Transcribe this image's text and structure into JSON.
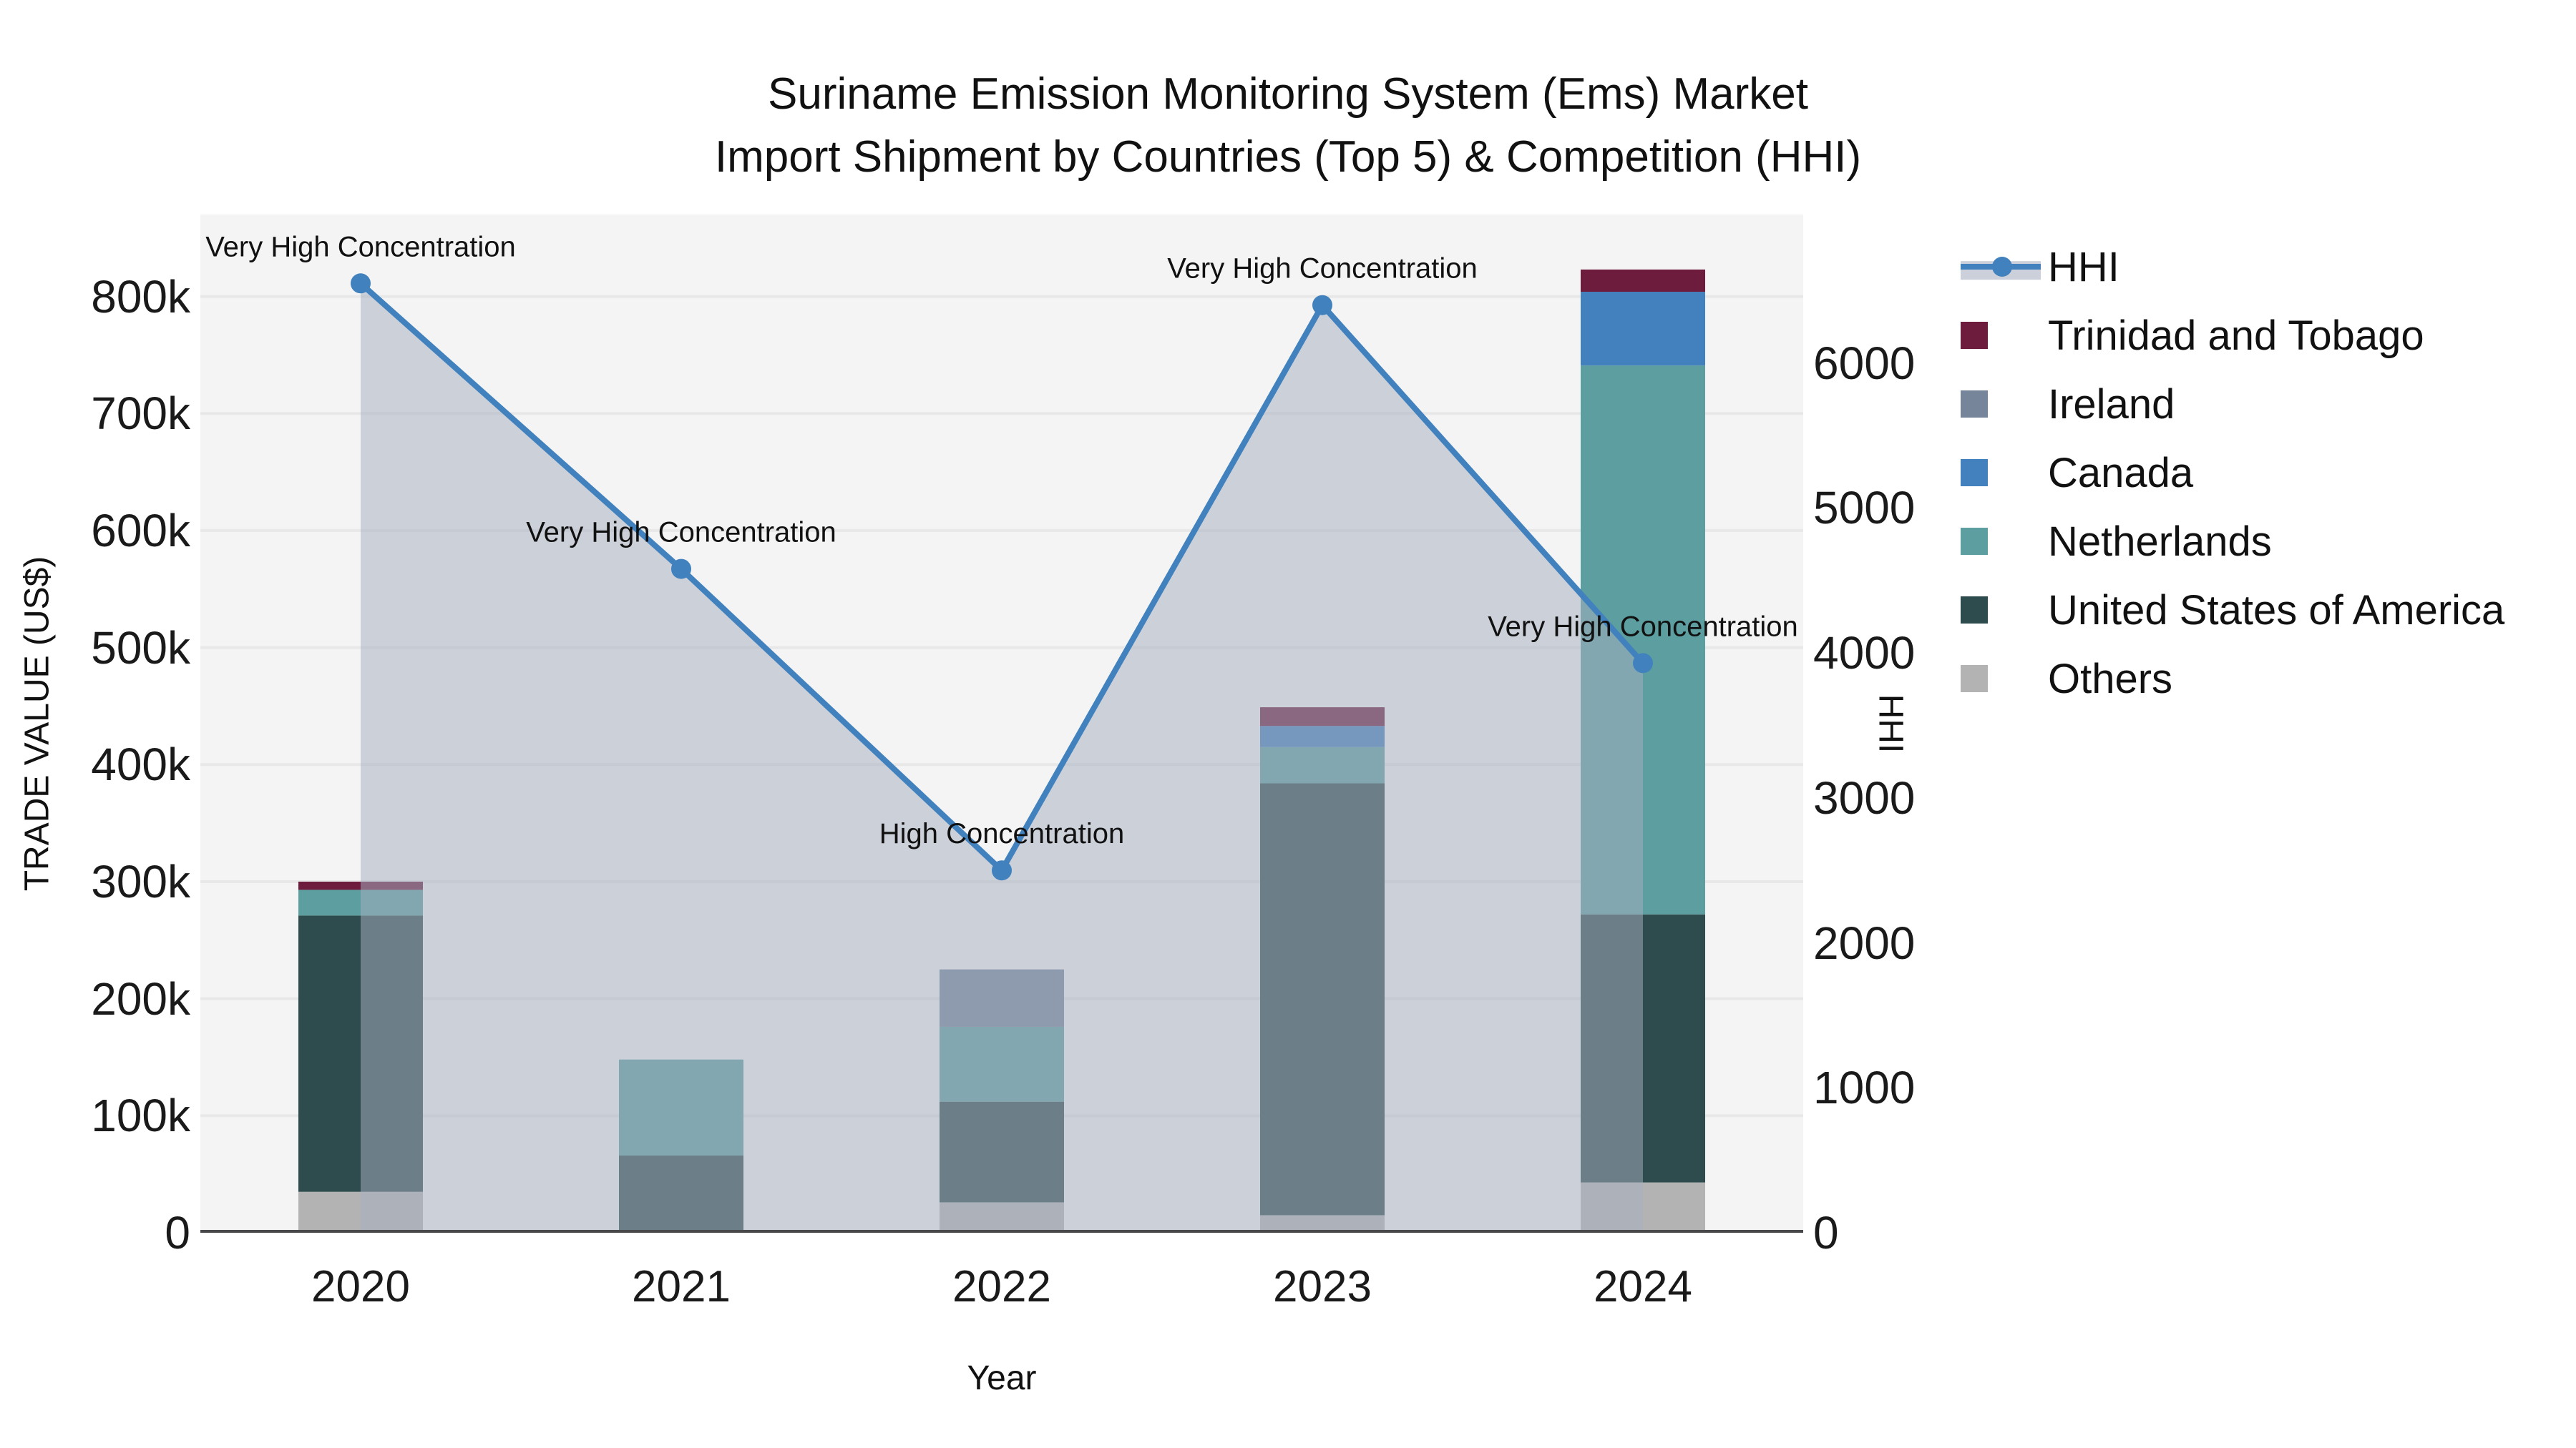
{
  "title": {
    "line1": "Suriname Emission Monitoring System (Ems) Market",
    "line2": "Import Shipment by Countries (Top 5) & Competition (HHI)"
  },
  "axes": {
    "x": {
      "title": "Year",
      "tick_labels": [
        "2020",
        "2021",
        "2022",
        "2023",
        "2024"
      ]
    },
    "y_left": {
      "title": "TRADE VALUE (US$)",
      "tick_labels": [
        "0",
        "100k",
        "200k",
        "300k",
        "400k",
        "500k",
        "600k",
        "700k",
        "800k"
      ],
      "tick_values": [
        0,
        100000,
        200000,
        300000,
        400000,
        500000,
        600000,
        700000,
        800000
      ]
    },
    "y_right": {
      "title": "HHI",
      "tick_labels": [
        "0",
        "1000",
        "2000",
        "3000",
        "4000",
        "5000",
        "6000"
      ],
      "tick_values": [
        0,
        1000,
        2000,
        3000,
        4000,
        5000,
        6000
      ]
    }
  },
  "legend": {
    "items": [
      {
        "label": "HHI",
        "type": "line",
        "color": "#4181bd",
        "band": "#cbd0da"
      },
      {
        "label": "Trinidad and Tobago",
        "type": "square",
        "color": "#6d1c3d"
      },
      {
        "label": "Ireland",
        "type": "square",
        "color": "#76859a"
      },
      {
        "label": "Canada",
        "type": "square",
        "color": "#4381be"
      },
      {
        "label": "Netherlands",
        "type": "square",
        "color": "#5d9fa0"
      },
      {
        "label": "United States of America",
        "type": "square",
        "color": "#2e4c4d"
      },
      {
        "label": "Others",
        "type": "square",
        "color": "#b3b3b3"
      }
    ]
  },
  "chart_data": {
    "type": "bar",
    "subtype": "stacked-bar-with-line",
    "categories": [
      "2020",
      "2021",
      "2022",
      "2023",
      "2024"
    ],
    "bar_value_unit": "US$",
    "stack_order_bottom_to_top": [
      "Others",
      "United States of America",
      "Netherlands",
      "Canada",
      "Ireland",
      "Trinidad and Tobago"
    ],
    "series": [
      {
        "name": "Trinidad and Tobago",
        "type": "bar",
        "color": "#6d1c3d",
        "values": [
          7000,
          0,
          0,
          16000,
          19000
        ]
      },
      {
        "name": "Ireland",
        "type": "bar",
        "color": "#76859a",
        "values": [
          0,
          0,
          49000,
          0,
          0
        ]
      },
      {
        "name": "Canada",
        "type": "bar",
        "color": "#4381be",
        "values": [
          0,
          0,
          0,
          18000,
          63000
        ]
      },
      {
        "name": "Netherlands",
        "type": "bar",
        "color": "#5d9fa0",
        "values": [
          22000,
          82000,
          64000,
          31000,
          469000
        ]
      },
      {
        "name": "United States of America",
        "type": "bar",
        "color": "#2e4c4d",
        "values": [
          236000,
          66000,
          86000,
          369000,
          229000
        ]
      },
      {
        "name": "Others",
        "type": "bar",
        "color": "#b3b3b3",
        "values": [
          35000,
          0,
          26000,
          15000,
          43000
        ]
      },
      {
        "name": "HHI",
        "type": "line",
        "axis": "right",
        "color": "#4181bd",
        "area_fill": "rgba(164,174,192,0.52)",
        "values": [
          6550,
          4580,
          2500,
          6400,
          3930
        ]
      }
    ],
    "annotations": [
      {
        "category": "2020",
        "text": "Very High Concentration"
      },
      {
        "category": "2021",
        "text": "Very High Concentration"
      },
      {
        "category": "2022",
        "text": "High Concentration"
      },
      {
        "category": "2023",
        "text": "Very High Concentration"
      },
      {
        "category": "2024",
        "text": "Very High Concentration"
      }
    ],
    "title": "Suriname Emission Monitoring System (Ems) Market Import Shipment by Countries (Top 5) & Competition (HHI)",
    "xlabel": "Year",
    "ylabel_left": "TRADE VALUE (US$)",
    "ylabel_right": "HHI",
    "y_left_range": [
      0,
      870000
    ],
    "y_right_range": [
      0,
      7025
    ],
    "grid": true,
    "legend_position": "right",
    "plot_background": "#f4f4f4",
    "grid_color": "#e8e8e8",
    "axis_line_color": "#48484a"
  }
}
